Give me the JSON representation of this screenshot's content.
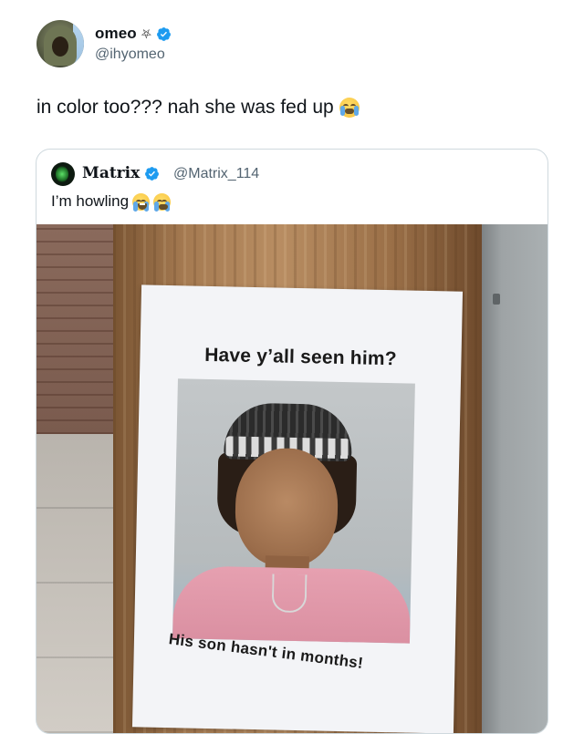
{
  "tweet": {
    "author_name": "omeo",
    "author_symbol": "⛧",
    "author_handle": "@ihyomeo",
    "text": "in color too??? nah she was fed up",
    "text_emoji": "loudly-crying-face"
  },
  "quote": {
    "author_name": "Matrix",
    "author_handle": "@Matrix_114",
    "text": "I’m howling",
    "text_emojis": [
      "face-with-tears-of-joy",
      "loudly-crying-face"
    ]
  },
  "flyer": {
    "title": "Have y’all seen him?",
    "caption": "His son hasn't in months!"
  },
  "colors": {
    "verified_blue": "#1d9bf0",
    "handle_gray": "#536471",
    "border": "#cfd9de"
  }
}
